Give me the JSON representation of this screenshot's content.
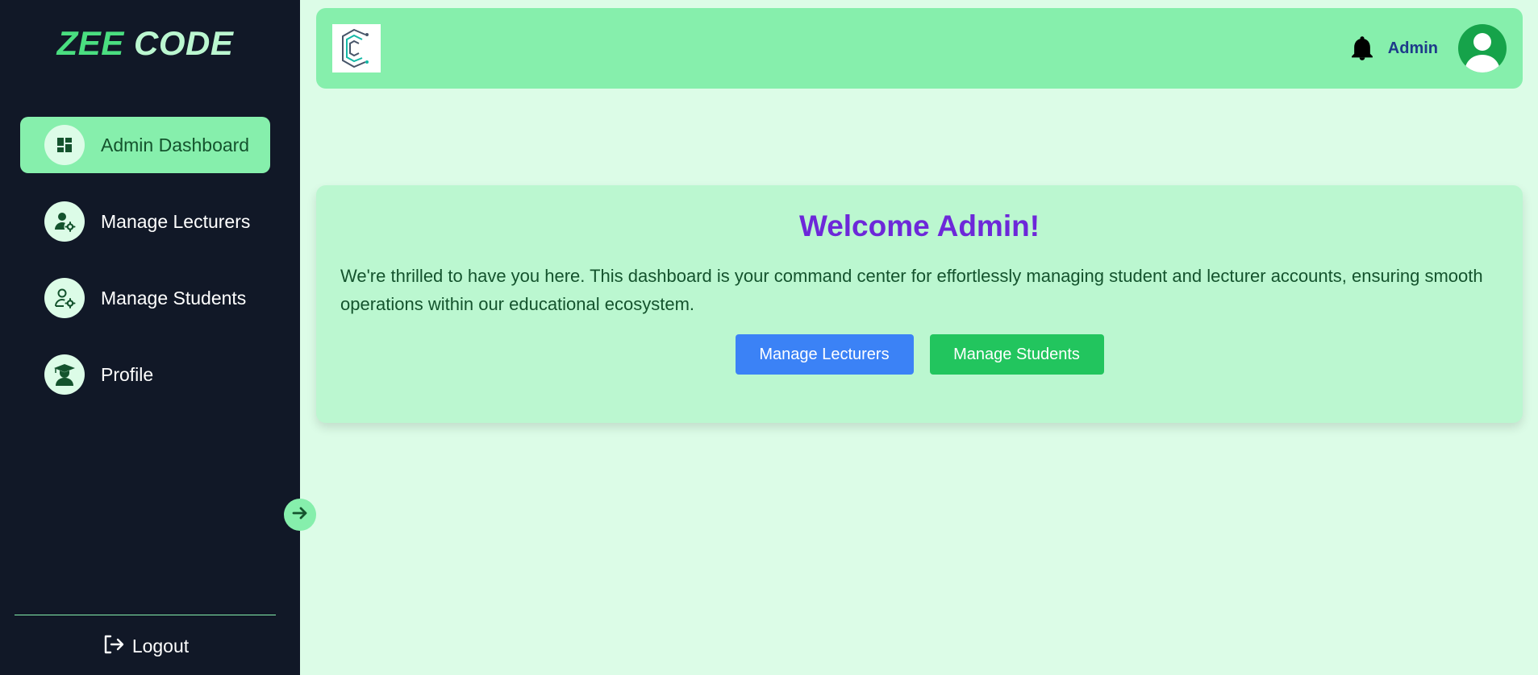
{
  "sidebar": {
    "brand_part1": "ZEE",
    "brand_part2": "CODE",
    "items": [
      {
        "label": "Admin Dashboard",
        "icon": "dashboard-icon",
        "active": true
      },
      {
        "label": "Manage Lecturers",
        "icon": "user-gear-icon",
        "active": false
      },
      {
        "label": "Manage Students",
        "icon": "user-gear-outline-icon",
        "active": false
      },
      {
        "label": "Profile",
        "icon": "graduate-icon",
        "active": false
      }
    ],
    "logout_label": "Logout"
  },
  "header": {
    "logo_icon": "c-logo-icon",
    "user_name": "Admin",
    "bell_icon": "bell-icon",
    "avatar_icon": "avatar-icon"
  },
  "welcome": {
    "title": "Welcome Admin!",
    "text": "We're thrilled to have you here. This dashboard is your command center for effortlessly managing student and lecturer accounts, ensuring smooth operations within our educational ecosystem.",
    "buttons": {
      "lecturers": "Manage Lecturers",
      "students": "Manage Students"
    }
  },
  "colors": {
    "sidebar_bg": "#111827",
    "accent_green": "#86efac",
    "page_bg": "#dcfce7",
    "card_bg": "#bbf7d0",
    "title_purple": "#6d28d9",
    "btn_blue": "#3b82f6",
    "btn_green": "#22c55e"
  }
}
